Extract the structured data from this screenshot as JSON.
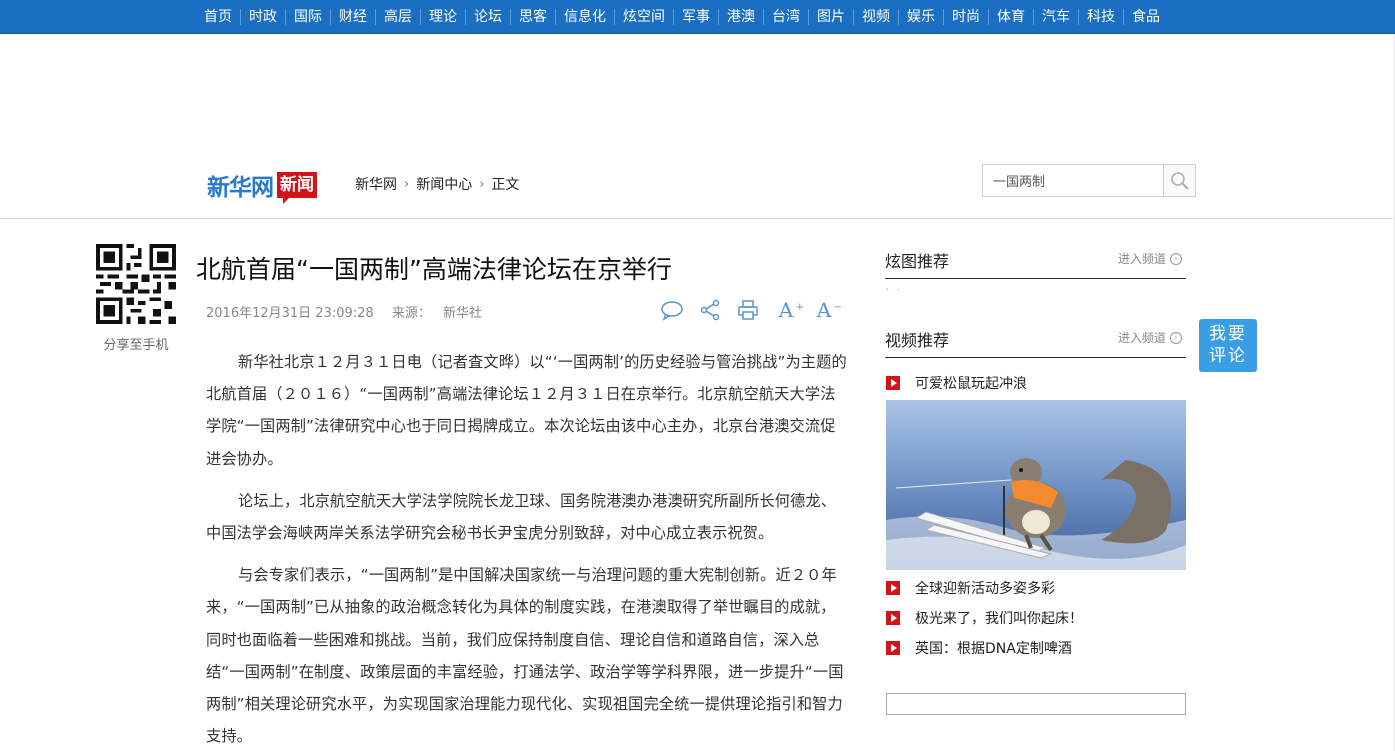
{
  "nav": [
    "首页",
    "时政",
    "国际",
    "财经",
    "高层",
    "理论",
    "论坛",
    "思客",
    "信息化",
    "炫空间",
    "军事",
    "港澳",
    "台湾",
    "图片",
    "视频",
    "娱乐",
    "时尚",
    "体育",
    "汽车",
    "科技",
    "食品"
  ],
  "logo": {
    "brand": "新华网",
    "tag": "新闻"
  },
  "breadcrumb": [
    "新华网",
    "新闻中心",
    "正文"
  ],
  "search": {
    "value": "一国两制"
  },
  "qr_label": "分享至手机",
  "article": {
    "title": "北航首届“一国两制”高端法律论坛在京举行",
    "datetime": "2016年12月31日 23:09:28",
    "source_label": "来源：",
    "source": "新华社",
    "paragraphs": [
      "新华社北京１２月３１日电（记者査文晔）以“‘一国两制’的历史经验与管治挑战”为主题的北航首届（２０１６）“一国两制”高端法律论坛１２月３１日在京举行。北京航空航天大学法学院“一国两制”法律研究中心也于同日揭牌成立。本次论坛由该中心主办，北京台港澳交流促进会协办。",
      "论坛上，北京航空航天大学法学院院长龙卫球、国务院港澳办港澳研究所副所长何德龙、中国法学会海峡两岸关系法学研究会秘书长尹宝虎分别致辞，对中心成立表示祝贺。",
      "与会专家们表示，“一国两制”是中国解决国家统一与治理问题的重大宪制创新。近２０年来，“一国两制”已从抽象的政治概念转化为具体的制度实践，在港澳取得了举世瞩目的成就，同时也面临着一些困难和挑战。当前，我们应保持制度自信、理论自信和道路自信，深入总结“一国两制”在制度、政策层面的丰富经验，打通法学、政治学等学科界限，进一步提升“一国两制”相关理论研究水平，为实现国家治理能力现代化、实现祖国完全统一提供理论指引和智力支持。"
    ]
  },
  "tools": {
    "font_up": "A",
    "font_down": "A"
  },
  "sidebar": {
    "gallery": {
      "title": "炫图推荐",
      "more": "进入频道"
    },
    "video": {
      "title": "视频推荐",
      "more": "进入频道",
      "items": [
        "可爱松鼠玩起冲浪",
        "全球迎新活动多姿多彩",
        "极光来了，我们叫你起床！",
        "英国：根据DNA定制啤酒"
      ]
    }
  },
  "comment_button": {
    "line1": "我要",
    "line2": "评论"
  },
  "colors": {
    "nav_bg": "#1a6fc2",
    "accent_red": "#d3131a",
    "comment_blue": "#3a9ee5"
  }
}
